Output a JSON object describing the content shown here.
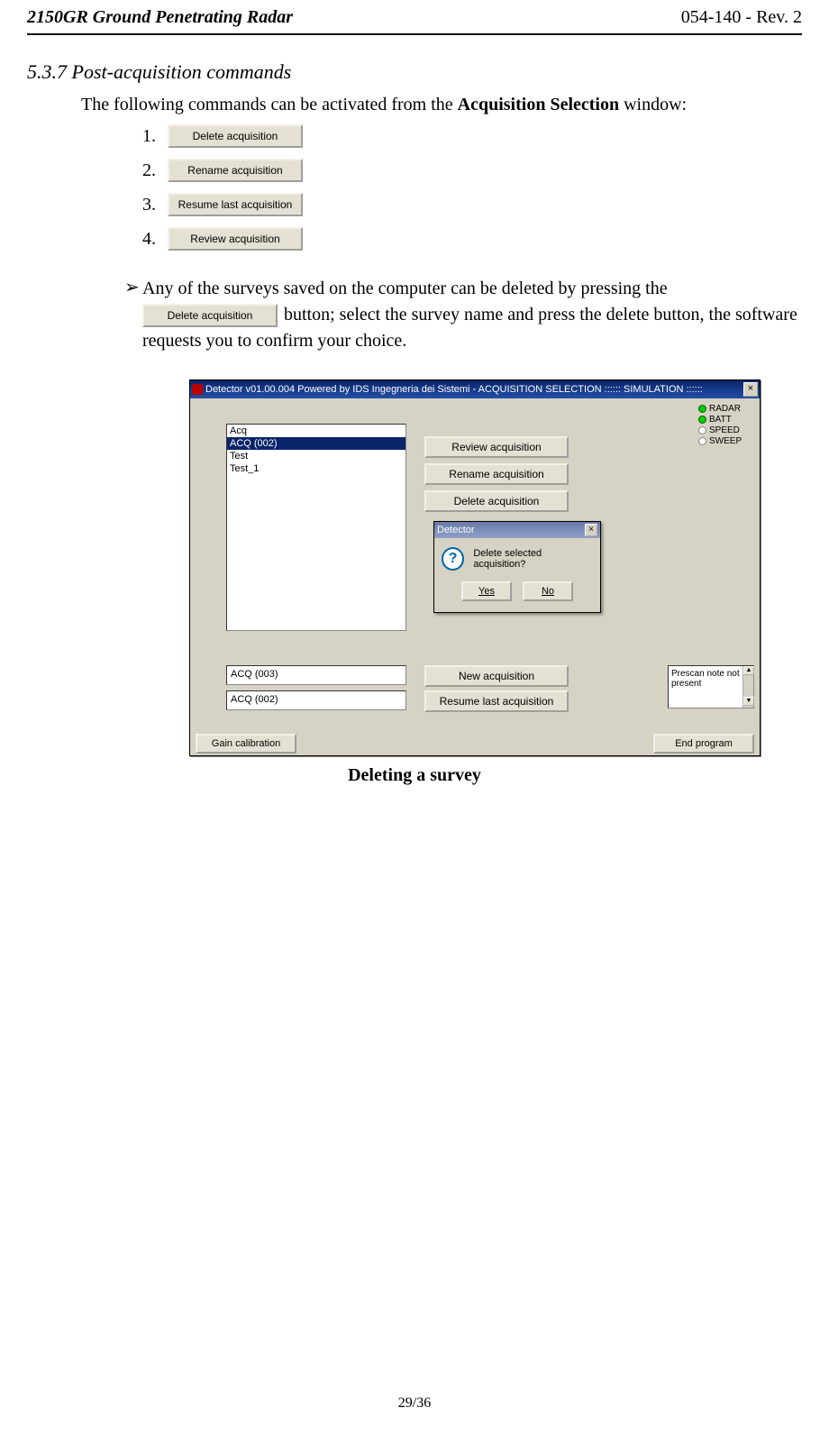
{
  "header": {
    "left": "2150GR Ground Penetrating Radar",
    "right": "054-140 - Rev. 2"
  },
  "section_title": "5.3.7 Post-acquisition commands",
  "intro": {
    "pre": "The following commands can be activated from the ",
    "bold": "Acquisition Selection",
    "post": "  window:"
  },
  "list_buttons": {
    "b1": "Delete acquisition",
    "b2": "Rename acquisition",
    "b3": "Resume last acquisition",
    "b4": "Review acquisition"
  },
  "list_nums": {
    "n1": "1.",
    "n2": "2.",
    "n3": "3.",
    "n4": "4."
  },
  "bullet": {
    "sym": "➢",
    "line1": "Any of the surveys saved on the computer can be deleted by pressing the ",
    "inline_btn": "Delete acquisition",
    "line2": " button; select the survey name and press the delete button, the software requests you to confirm your choice."
  },
  "screenshot": {
    "titlebar": "Detector v01.00.004 Powered by IDS Ingegneria dei Sistemi - ACQUISITION SELECTION :::::: SIMULATION ::::::",
    "close_glyph": "×",
    "list_items": {
      "i0": "Acq",
      "i1": "ACQ (002)",
      "i2": "Test",
      "i3": "Test_1"
    },
    "right_buttons": {
      "rb1": "Review acquisition",
      "rb2": "Rename acquisition",
      "rb3": "Delete acquisition",
      "rb4": "New acquisition",
      "rb5": "Resume last acquisition"
    },
    "fields": {
      "f1": "ACQ (003)",
      "f2": "ACQ (002)"
    },
    "bottom_buttons": {
      "gain": "Gain calibration",
      "endp": "End program"
    },
    "status": {
      "s1": "RADAR",
      "s2": "BATT",
      "s3": "SPEED",
      "s4": "SWEEP"
    },
    "note": "Prescan note not present",
    "dialog": {
      "title": "Detector",
      "question": "Delete selected acquisition?",
      "yes": "Yes",
      "no": "No"
    },
    "scroll_up": "▲",
    "scroll_down": "▼"
  },
  "caption": "Deleting a survey",
  "footer": "29/36"
}
